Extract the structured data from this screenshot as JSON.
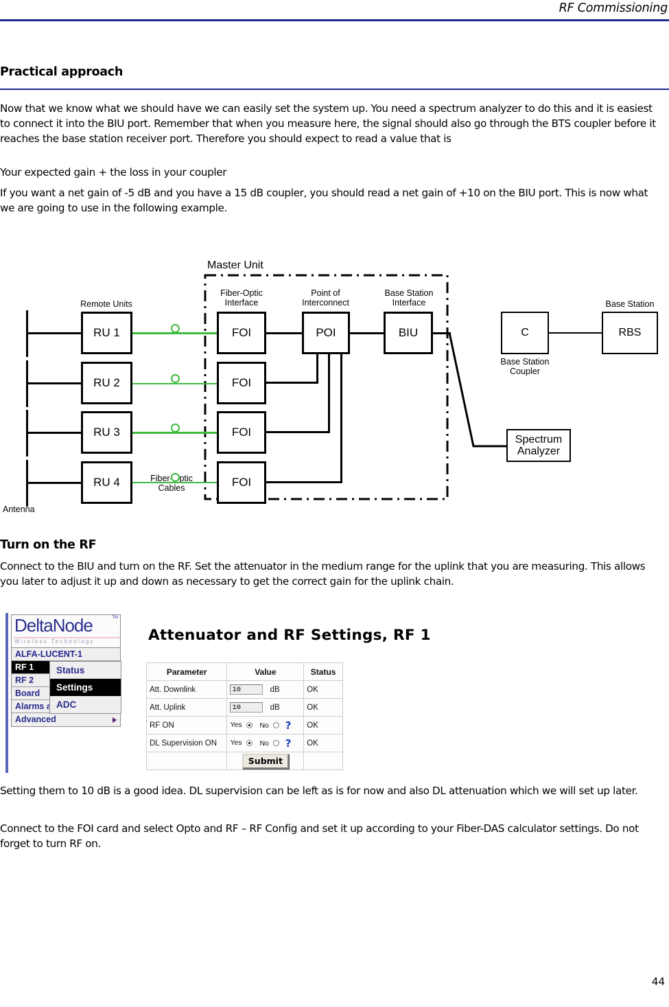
{
  "header": {
    "running_head": "RF Commissioning",
    "page_number": "44"
  },
  "sections": {
    "practical_heading": "Practical approach",
    "turnon_heading": "Turn on the RF"
  },
  "paragraphs": {
    "p1": "Now that we know what we should have we can easily set the system up. You need a spectrum analyzer to do this and it is easiest to connect it into the BIU port. Remember that when you measure here, the signal should also go through the BTS coupler before it reaches the base station receiver port. Therefore you should expect to read a value that is",
    "p2": "Your expected gain + the loss in your coupler",
    "p3": "If you want a net gain of -5 dB and you have a 15 dB coupler, you should read a net gain of +10 on the BIU port. This is now what we are going to use in the following example.",
    "p4": "Connect to the BIU and turn on the RF. Set the attenuator in the medium range for the uplink that you are measuring. This allows you later to adjust it up and down as necessary to get the correct gain for the uplink chain.",
    "p5": "Setting them to 10 dB is a good idea. DL supervision can be left as is for now and also DL attenuation which we will set up later.",
    "p6": "Connect to the FOI card and select Opto and RF – RF Config and set it up according to your Fiber-DAS calculator settings. Do not forget to turn RF on."
  },
  "diagram": {
    "title": "Master Unit",
    "labels": {
      "remote_units": "Remote Units",
      "fiber_optic_interface": "Fiber-Optic\nInterface",
      "point_of_interconnect": "Point of\nInterconnect",
      "base_station_interface": "Base Station\nInterface",
      "base_station": "Base Station",
      "base_station_coupler": "Base Station\nCoupler",
      "antenna": "Antenna",
      "fiber_optic_cables": "Fiber-Optic\nCables"
    },
    "remote_units": [
      "RU 1",
      "RU 2",
      "RU 3",
      "RU 4"
    ],
    "foi_boxes": [
      "FOI",
      "FOI",
      "FOI",
      "FOI"
    ],
    "poi": "POI",
    "biu": "BIU",
    "coupler": "C",
    "rbs": "RBS",
    "spectrum_analyzer": "Spectrum\nAnalyzer",
    "colors": {
      "fiber": "#3dbb3d",
      "wire": "#000000"
    }
  },
  "webui": {
    "logo": {
      "brand": "DeltaNode",
      "tagline": "Wireless   Technology",
      "trademark": "TM",
      "brand_color": "#2b2f8f"
    },
    "nav": [
      {
        "label": "ALFA-LUCENT-1",
        "active": false,
        "arrow": false
      },
      {
        "label": "RF 1",
        "active": true,
        "arrow": true
      },
      {
        "label": "RF 2",
        "active": false,
        "arrow": true
      },
      {
        "label": "Board",
        "active": false,
        "arrow": true
      },
      {
        "label": "Alarms and Events",
        "active": false,
        "arrow": true
      },
      {
        "label": "Advanced",
        "active": false,
        "arrow": true
      }
    ],
    "submenu": [
      {
        "label": "Status",
        "active": false
      },
      {
        "label": "Settings",
        "active": true
      },
      {
        "label": "ADC",
        "active": false
      }
    ],
    "panel_title": "Attenuator and RF Settings, RF 1",
    "table": {
      "headers": [
        "Parameter",
        "Value",
        "Status"
      ],
      "rows": [
        {
          "parameter": "Att. Downlink",
          "value": "10",
          "unit": "dB",
          "status": "OK",
          "type": "input"
        },
        {
          "parameter": "Att. Uplink",
          "value": "10",
          "unit": "dB",
          "status": "OK",
          "type": "input"
        },
        {
          "parameter": "RF ON",
          "yes_label": "Yes",
          "no_label": "No",
          "selected": "Yes",
          "help": "?",
          "status": "OK",
          "type": "radio"
        },
        {
          "parameter": "DL Supervision ON",
          "yes_label": "Yes",
          "no_label": "No",
          "selected": "Yes",
          "help": "?",
          "status": "OK",
          "type": "radio"
        }
      ],
      "submit_label": "Submit"
    }
  }
}
